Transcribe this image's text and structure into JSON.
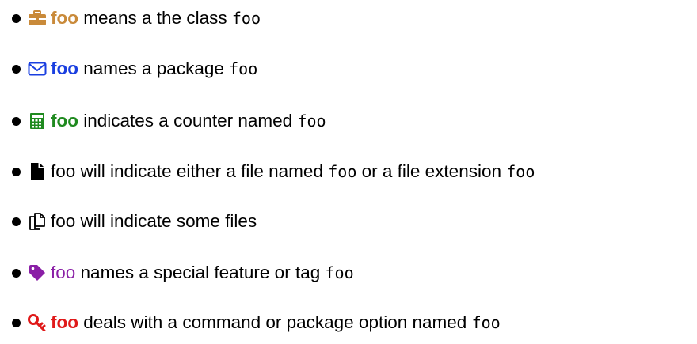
{
  "colors": {
    "class": "#c98a3a",
    "package": "#1a3fe0",
    "counter": "#1f8a1f",
    "file": "#000000",
    "files": "#000000",
    "feature": "#8a1fa6",
    "option": "#e01919"
  },
  "items": [
    {
      "icon": "briefcase-icon",
      "key": "foo",
      "text": "means a the class",
      "code": "foo",
      "text_after": "",
      "code_after": ""
    },
    {
      "icon": "envelope-icon",
      "key": "foo",
      "text": "names a package",
      "code": "foo",
      "text_after": "",
      "code_after": ""
    },
    {
      "icon": "calculator-icon",
      "key": "foo",
      "text": "indicates a counter named",
      "code": "foo",
      "text_after": "",
      "code_after": ""
    },
    {
      "icon": "file-icon",
      "key": "foo",
      "text": "will indicate either a file named",
      "code": "foo",
      "text_after": "or a file extension",
      "code_after": "foo"
    },
    {
      "icon": "files-icon",
      "key": "foo",
      "text": "will indicate some files",
      "code": "",
      "text_after": "",
      "code_after": ""
    },
    {
      "icon": "tag-icon",
      "key": "foo",
      "text": "names a special feature or tag",
      "code": "foo",
      "text_after": "",
      "code_after": ""
    },
    {
      "icon": "key-icon",
      "key": "foo",
      "text": "deals with a command or package option named",
      "code": "foo",
      "text_after": "",
      "code_after": ""
    }
  ]
}
